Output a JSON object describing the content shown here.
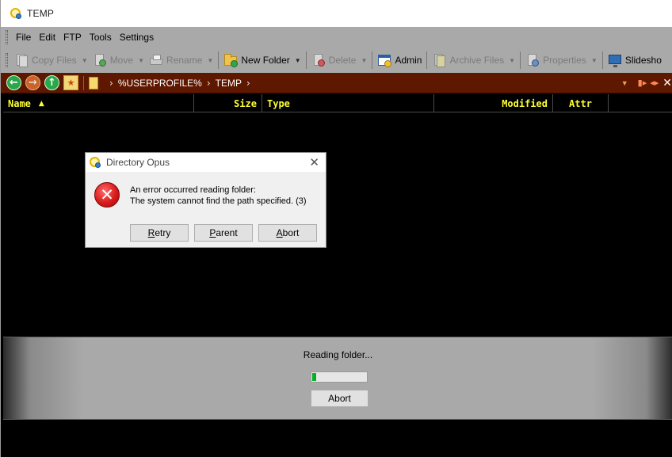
{
  "window": {
    "title": "TEMP"
  },
  "menu": {
    "items": [
      "File",
      "Edit",
      "FTP",
      "Tools",
      "Settings"
    ]
  },
  "toolbar": {
    "copy_files": "Copy Files",
    "move": "Move",
    "rename": "Rename",
    "new_folder": "New Folder",
    "delete": "Delete",
    "admin": "Admin",
    "archive_files": "Archive Files",
    "properties": "Properties",
    "slideshow": "Slidesho"
  },
  "path": {
    "segments": [
      "%USERPROFILE%",
      "TEMP"
    ]
  },
  "columns": {
    "name": "Name",
    "size": "Size",
    "type": "Type",
    "modified": "Modified",
    "attr": "Attr"
  },
  "reading": {
    "text": "Reading folder...",
    "progress": 0.08,
    "abort_label": "Abort"
  },
  "dialog": {
    "title": "Directory Opus",
    "message_line1": "An error occurred reading folder:",
    "message_line2": "The system cannot find the path specified. (3)",
    "retry_label": "Retry",
    "parent_label": "Parent",
    "abort_label": "Abort"
  },
  "colors": {
    "path_bar": "#5f1800",
    "column_text": "#ffff33",
    "progress_fill": "#06b025",
    "error_icon": "#d91a1a"
  }
}
